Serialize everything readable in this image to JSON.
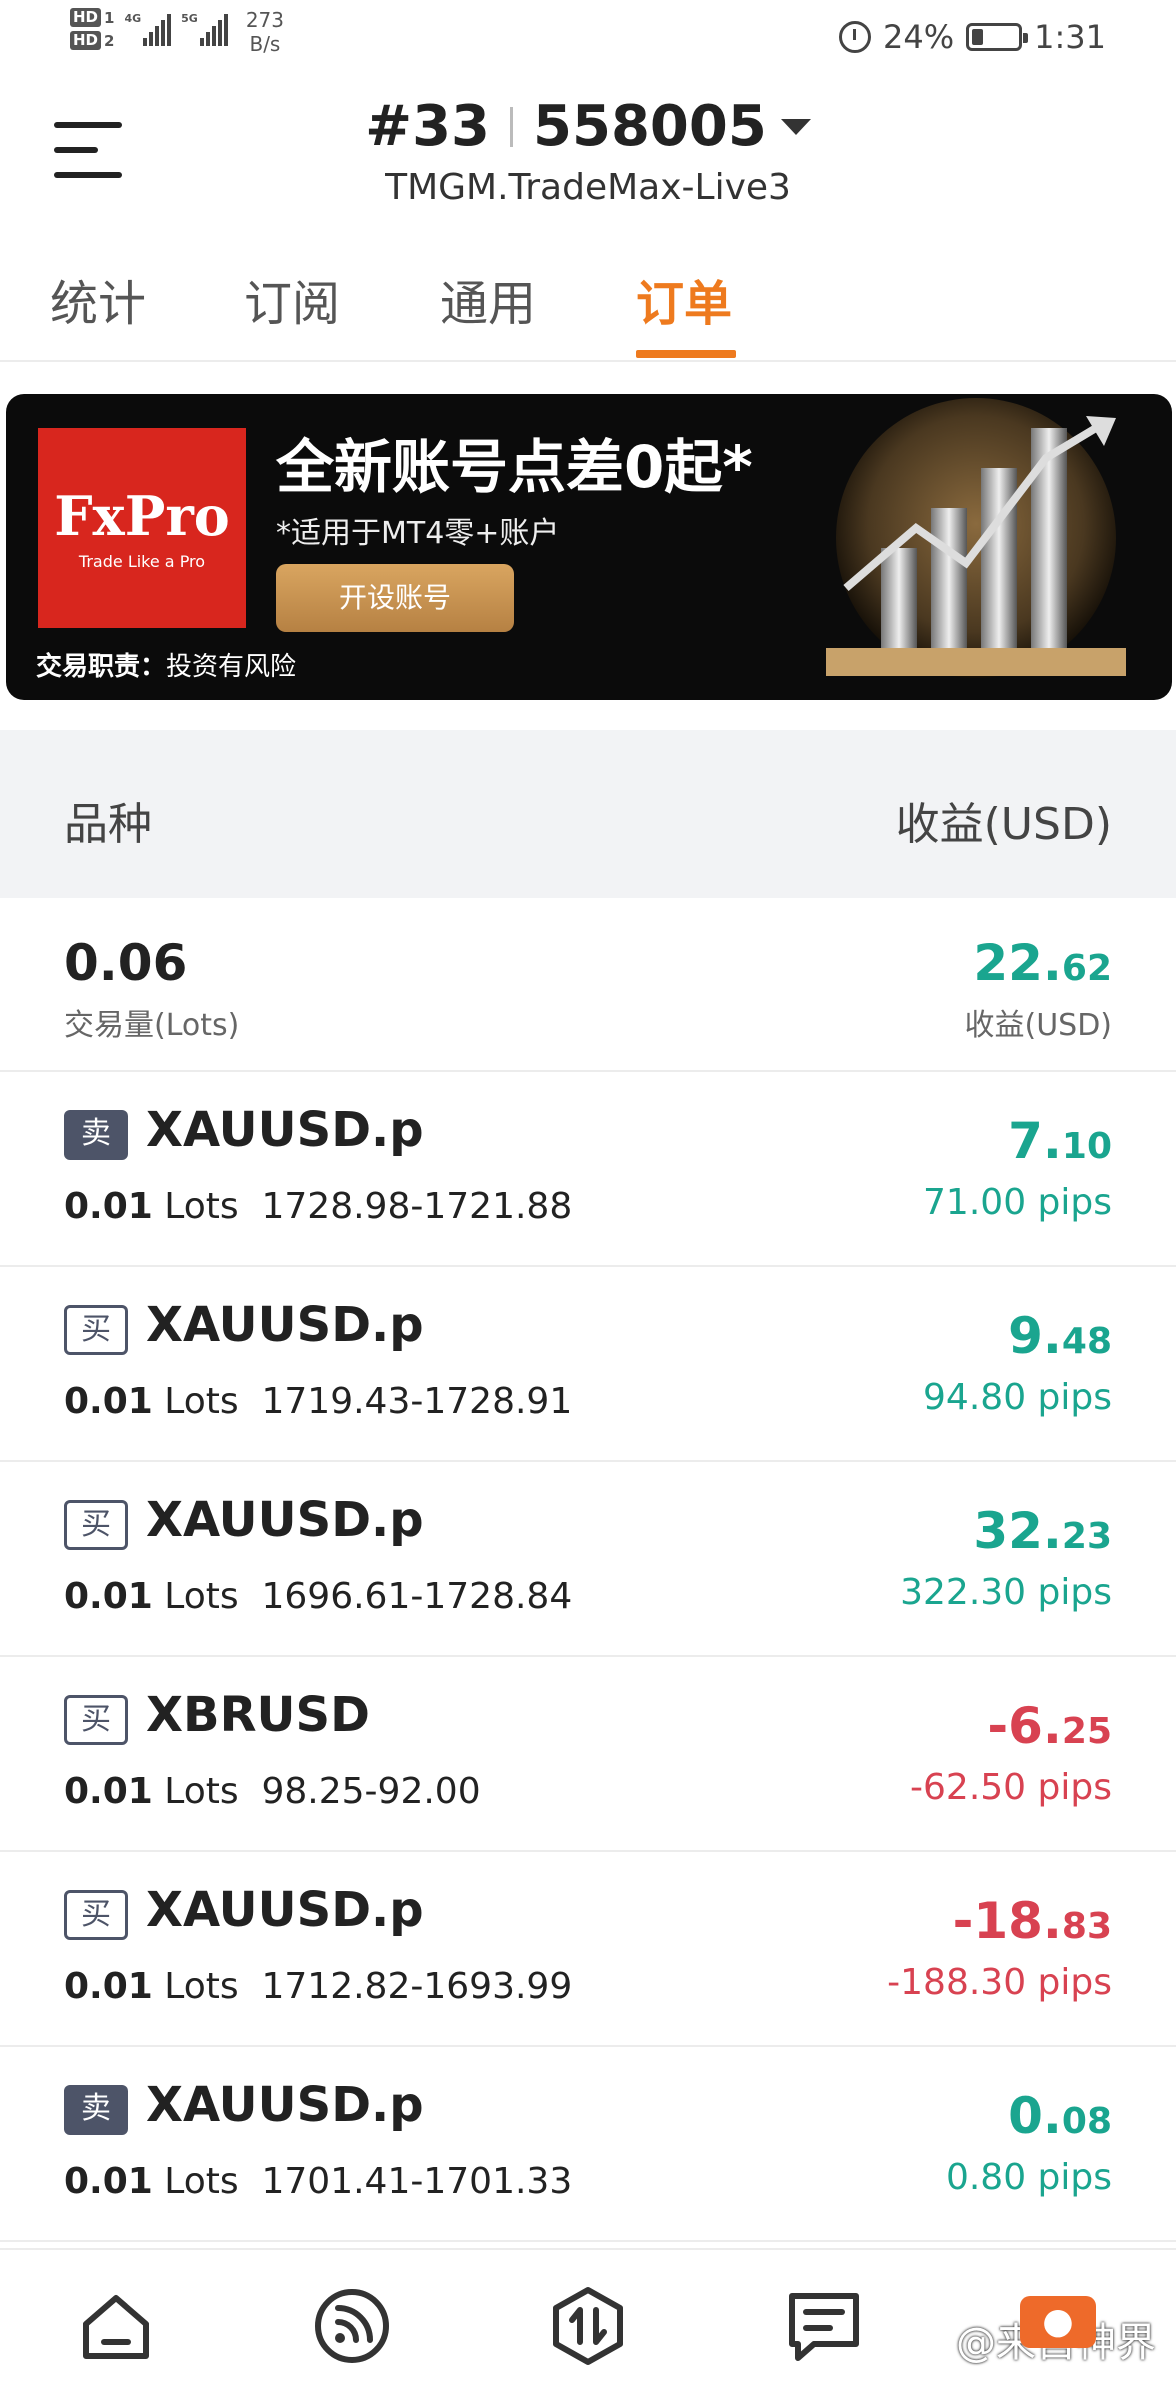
{
  "status_bar": {
    "sim1": "HD",
    "sim1_num": "1",
    "sim2": "HD",
    "sim2_num": "2",
    "net1": "4G",
    "net2": "5G",
    "speed_value": "273",
    "speed_unit": "B/s",
    "battery": "24%",
    "time": "1:31"
  },
  "header": {
    "account_prefix": "#33",
    "account_number": "558005",
    "server": "TMGM.TradeMax-Live3"
  },
  "tabs": [
    {
      "label": "统计",
      "active": false
    },
    {
      "label": "订阅",
      "active": false
    },
    {
      "label": "通用",
      "active": false
    },
    {
      "label": "订单",
      "active": true
    }
  ],
  "banner": {
    "logo_name": "FxPro",
    "logo_tagline": "Trade Like a Pro",
    "title": "全新账号点差0起*",
    "subtitle": "*适用于MT4零+账户",
    "button_label": "开设账号",
    "risk_label": "交易职责：",
    "risk_text": "投资有风险"
  },
  "table": {
    "col_symbol": "品种",
    "col_profit": "收益(USD)"
  },
  "summary": {
    "lots": "0.06",
    "lots_label": "交易量(Lots)",
    "profit_int": "22.",
    "profit_dec": "62",
    "profit_label": "收益(USD)"
  },
  "orders": [
    {
      "side": "卖",
      "type": "sell",
      "symbol": "XAUUSD.p",
      "lots": "0.01",
      "lots_unit": "Lots",
      "prices": "1728.98-1721.88",
      "profit_int": "7.",
      "profit_dec": "10",
      "pips": "71.00 pips",
      "sign": "pos"
    },
    {
      "side": "买",
      "type": "buy",
      "symbol": "XAUUSD.p",
      "lots": "0.01",
      "lots_unit": "Lots",
      "prices": "1719.43-1728.91",
      "profit_int": "9.",
      "profit_dec": "48",
      "pips": "94.80 pips",
      "sign": "pos"
    },
    {
      "side": "买",
      "type": "buy",
      "symbol": "XAUUSD.p",
      "lots": "0.01",
      "lots_unit": "Lots",
      "prices": "1696.61-1728.84",
      "profit_int": "32.",
      "profit_dec": "23",
      "pips": "322.30 pips",
      "sign": "pos"
    },
    {
      "side": "买",
      "type": "buy",
      "symbol": "XBRUSD",
      "lots": "0.01",
      "lots_unit": "Lots",
      "prices": "98.25-92.00",
      "profit_int": "-6.",
      "profit_dec": "25",
      "pips": "-62.50 pips",
      "sign": "neg"
    },
    {
      "side": "买",
      "type": "buy",
      "symbol": "XAUUSD.p",
      "lots": "0.01",
      "lots_unit": "Lots",
      "prices": "1712.82-1693.99",
      "profit_int": "-18.",
      "profit_dec": "83",
      "pips": "-188.30 pips",
      "sign": "neg"
    },
    {
      "side": "卖",
      "type": "sell",
      "symbol": "XAUUSD.p",
      "lots": "0.01",
      "lots_unit": "Lots",
      "prices": "1701.41-1701.33",
      "profit_int": "0.",
      "profit_dec": "08",
      "pips": "0.80 pips",
      "sign": "pos"
    }
  ],
  "bottom_nav": {
    "items": [
      "home-icon",
      "signal-feed-icon",
      "trade-icon",
      "orders-list-icon"
    ],
    "watermark": "@来自神界"
  },
  "colors": {
    "accent": "#ee7a1e",
    "positive": "#1aa58f",
    "negative": "#d84251",
    "badge": "#4d5468"
  }
}
